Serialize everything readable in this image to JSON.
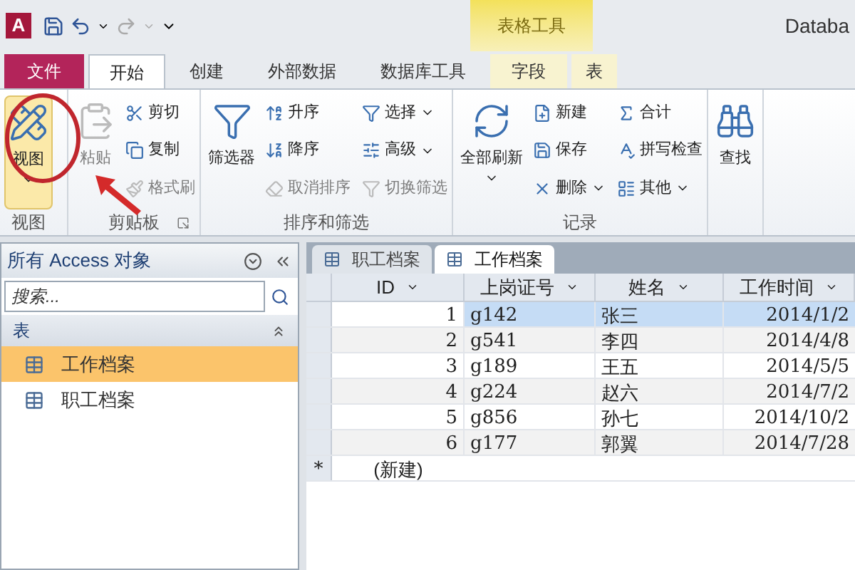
{
  "title_bar": {
    "app_logo": "A",
    "contextual_group": "表格工具",
    "title": "Databa"
  },
  "ribbon_tabs": [
    {
      "label": "文件",
      "kind": "file",
      "selected": false,
      "contextual": false
    },
    {
      "label": "开始",
      "kind": "tab",
      "selected": true,
      "contextual": false
    },
    {
      "label": "创建",
      "kind": "tab",
      "selected": false,
      "contextual": false
    },
    {
      "label": "外部数据",
      "kind": "tab",
      "selected": false,
      "contextual": false
    },
    {
      "label": "数据库工具",
      "kind": "tab",
      "selected": false,
      "contextual": false
    },
    {
      "label": "字段",
      "kind": "tab",
      "selected": false,
      "contextual": true
    },
    {
      "label": "表",
      "kind": "tab",
      "selected": false,
      "contextual": true
    }
  ],
  "ribbon_groups": [
    {
      "label": "视图",
      "commands": [
        {
          "label": "视图",
          "kind": "large",
          "disabled": false,
          "dropdown": true
        }
      ]
    },
    {
      "label": "剪贴板",
      "launcher": true,
      "commands": [
        {
          "label": "粘贴",
          "kind": "large",
          "disabled": true,
          "dropdown": false
        },
        {
          "label": "剪切",
          "kind": "small",
          "disabled": false,
          "dropdown": false
        },
        {
          "label": "复制",
          "kind": "small",
          "disabled": false,
          "dropdown": false
        },
        {
          "label": "格式刷",
          "kind": "small",
          "disabled": true,
          "dropdown": false
        }
      ]
    },
    {
      "label": "排序和筛选",
      "commands": [
        {
          "label": "筛选器",
          "kind": "large",
          "disabled": false,
          "dropdown": false
        },
        {
          "label": "升序",
          "kind": "small",
          "disabled": false,
          "dropdown": false
        },
        {
          "label": "降序",
          "kind": "small",
          "disabled": false,
          "dropdown": false
        },
        {
          "label": "取消排序",
          "kind": "small",
          "disabled": true,
          "dropdown": false
        },
        {
          "label": "选择",
          "kind": "small",
          "disabled": false,
          "dropdown": true
        },
        {
          "label": "高级",
          "kind": "small",
          "disabled": false,
          "dropdown": true
        },
        {
          "label": "切换筛选",
          "kind": "small",
          "disabled": true,
          "dropdown": false
        }
      ]
    },
    {
      "label": "记录",
      "commands": [
        {
          "label": "全部刷新",
          "kind": "large",
          "disabled": false,
          "dropdown": true
        },
        {
          "label": "新建",
          "kind": "small",
          "disabled": false,
          "dropdown": false
        },
        {
          "label": "保存",
          "kind": "small",
          "disabled": false,
          "dropdown": false
        },
        {
          "label": "删除",
          "kind": "small",
          "disabled": false,
          "dropdown": true
        },
        {
          "label": "合计",
          "kind": "small",
          "disabled": false,
          "dropdown": false
        },
        {
          "label": "拼写检查",
          "kind": "small",
          "disabled": false,
          "dropdown": false
        },
        {
          "label": "其他",
          "kind": "small",
          "disabled": false,
          "dropdown": true
        }
      ]
    },
    {
      "commands": [
        {
          "label": "查找",
          "kind": "large",
          "disabled": false,
          "dropdown": false
        }
      ]
    }
  ],
  "nav_pane": {
    "title": "所有 Access 对象",
    "search": {
      "placeholder": "搜索..."
    },
    "section": "表",
    "items": [
      {
        "label": "工作档案",
        "selected": true
      },
      {
        "label": "职工档案",
        "selected": false
      }
    ]
  },
  "document_tabs": [
    {
      "label": "职工档案",
      "selected": false
    },
    {
      "label": "工作档案",
      "selected": true
    }
  ],
  "table": {
    "columns": [
      "ID",
      "上岗证号",
      "姓名",
      "工作时间"
    ],
    "rows": [
      {
        "id": "1",
        "cert": "g142",
        "name": "张三",
        "date": "2014/1/2",
        "selected": true
      },
      {
        "id": "2",
        "cert": "g541",
        "name": "李四",
        "date": "2014/4/8",
        "selected": false
      },
      {
        "id": "3",
        "cert": "g189",
        "name": "王五",
        "date": "2014/5/5",
        "selected": false
      },
      {
        "id": "4",
        "cert": "g224",
        "name": "赵六",
        "date": "2014/7/2",
        "selected": false
      },
      {
        "id": "5",
        "cert": "g856",
        "name": "孙七",
        "date": "2014/10/2",
        "selected": false
      },
      {
        "id": "6",
        "cert": "g177",
        "name": "郭翼",
        "date": "2014/7/28",
        "selected": false
      }
    ],
    "new_row": {
      "marker": "*",
      "label": "(新建)"
    }
  }
}
